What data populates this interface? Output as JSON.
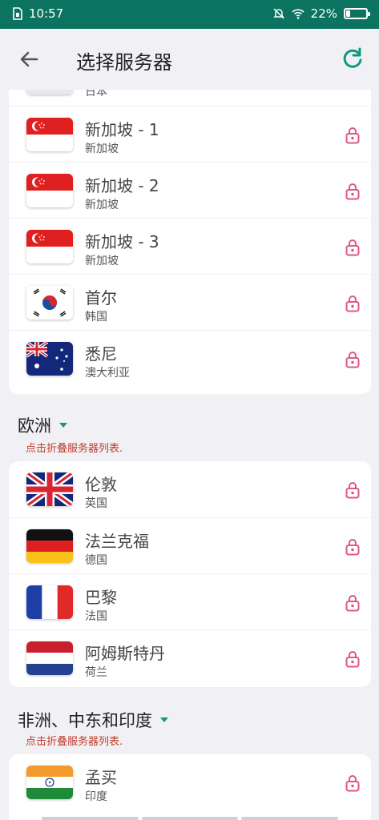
{
  "status_bar": {
    "time": "10:57",
    "battery": "22%",
    "battery_level": 0.22
  },
  "header": {
    "title": "选择服务器"
  },
  "partial_row": {
    "country": "日本"
  },
  "asia_servers": [
    {
      "city": "新加坡 - 1",
      "country": "新加坡",
      "flag": "singapore-flag"
    },
    {
      "city": "新加坡 - 2",
      "country": "新加坡",
      "flag": "singapore-flag"
    },
    {
      "city": "新加坡 - 3",
      "country": "新加坡",
      "flag": "singapore-flag"
    },
    {
      "city": "首尔",
      "country": "韩国",
      "flag": "korea-flag"
    },
    {
      "city": "悉尼",
      "country": "澳大利亚",
      "flag": "australia-flag"
    }
  ],
  "sections": {
    "europe": {
      "title": "欧洲",
      "hint": "点击折叠服务器列表.",
      "servers": [
        {
          "city": "伦敦",
          "country": "英国",
          "flag": "uk-flag"
        },
        {
          "city": "法兰克福",
          "country": "德国",
          "flag": "germany-flag"
        },
        {
          "city": "巴黎",
          "country": "法国",
          "flag": "france-flag"
        },
        {
          "city": "阿姆斯特丹",
          "country": "荷兰",
          "flag": "netherlands-flag"
        }
      ]
    },
    "africa": {
      "title": "非洲、中东和印度",
      "hint": "点击折叠服务器列表.",
      "servers": [
        {
          "city": "孟买",
          "country": "印度",
          "flag": "india-flag"
        }
      ]
    }
  },
  "colors": {
    "status_bar": "#0b7360",
    "accent": "#0b9a80",
    "lock": "#e0568a",
    "hint": "#c0392b"
  }
}
